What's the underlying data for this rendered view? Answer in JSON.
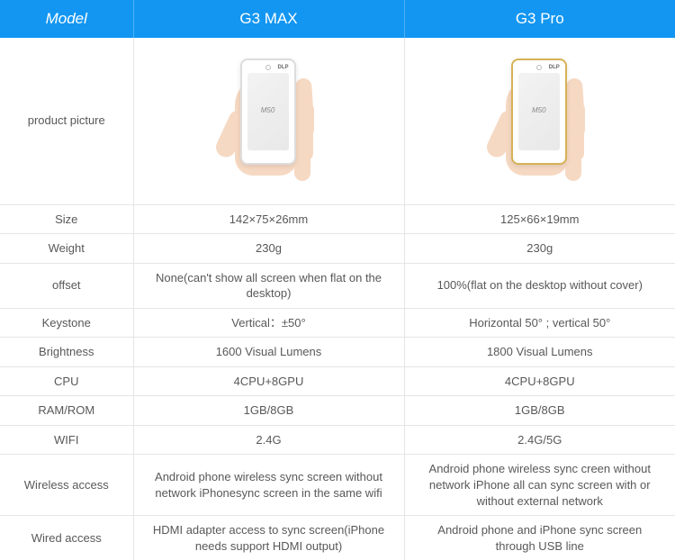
{
  "header": {
    "label_col": "Model",
    "col1": "G3 MAX",
    "col2": "G3 Pro"
  },
  "rows": [
    {
      "label": "product picture",
      "type": "picture"
    },
    {
      "label": "Size",
      "v1": "142×75×26mm",
      "v2": "125×66×19mm"
    },
    {
      "label": "Weight",
      "v1": "230g",
      "v2": "230g"
    },
    {
      "label": "offset",
      "v1": "None(can't show all screen when flat on the desktop)",
      "v2": "100%(flat on the desktop without cover)"
    },
    {
      "label": "Keystone",
      "v1": "Vertical：±50°",
      "v2": "Horizontal 50° ; vertical 50°"
    },
    {
      "label": "Brightness",
      "v1": "1600 Visual Lumens",
      "v2": "1800 Visual Lumens"
    },
    {
      "label": "CPU",
      "v1": "4CPU+8GPU",
      "v2": "4CPU+8GPU"
    },
    {
      "label": "RAM/ROM",
      "v1": "1GB/8GB",
      "v2": "1GB/8GB"
    },
    {
      "label": "WIFI",
      "v1": "2.4G",
      "v2": "2.4G/5G"
    },
    {
      "label": "Wireless access",
      "v1": "Android phone wireless sync screen without network iPhonesync screen in the same wifi",
      "v2": "Android phone wireless sync creen without network iPhone all can sync screen with or without external network"
    },
    {
      "label": "Wired access",
      "v1": "HDMI adapter access to sync screen(iPhone needs support HDMI output)",
      "v2": "Android phone and iPhone sync screen through USB line"
    }
  ],
  "logo": "M50",
  "dlp": "DLP"
}
